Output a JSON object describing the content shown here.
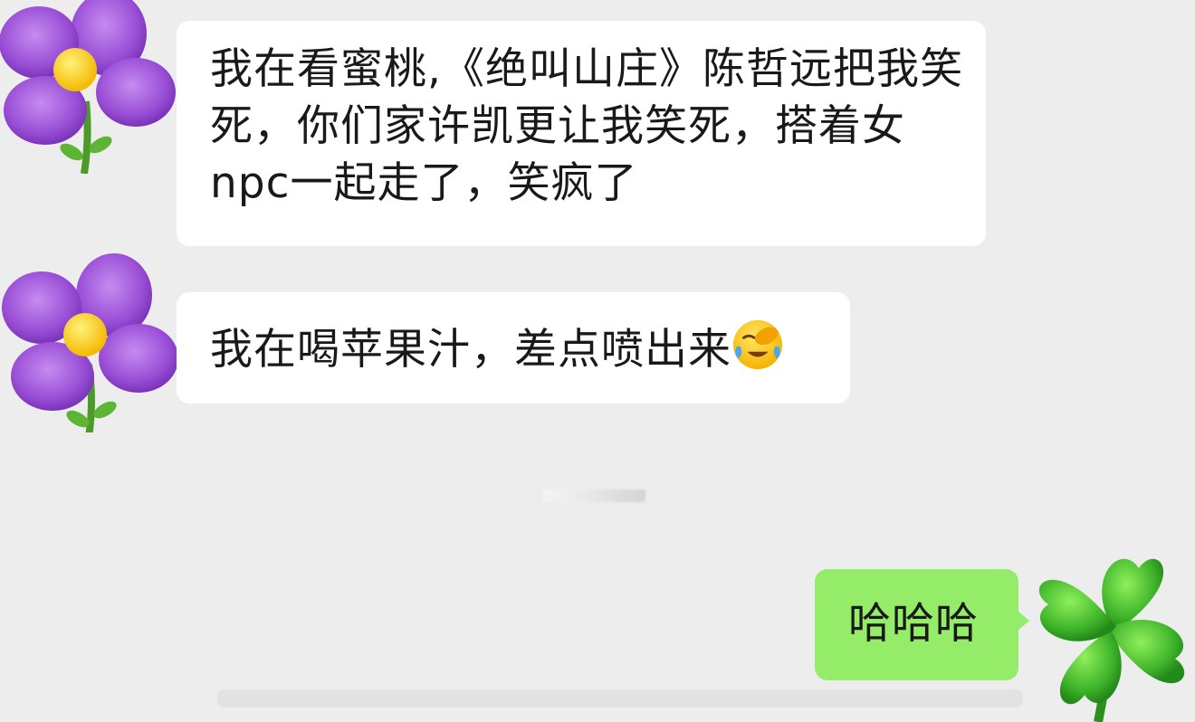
{
  "chat": {
    "messages": [
      {
        "sender": "contact",
        "avatar_icon": "purple-flower-icon",
        "text": "我在看蜜桃,《绝叫山庄》陈哲远把我笑死，你们家许凯更让我笑死，搭着女npc一起走了，笑疯了"
      },
      {
        "sender": "contact",
        "avatar_icon": "purple-flower-icon",
        "text": "我在喝苹果汁，差点喷出来",
        "emoji": "face-exhaling-tears-icon"
      },
      {
        "sender": "me",
        "avatar_icon": "four-leaf-clover-icon",
        "text": "哈哈哈"
      }
    ]
  },
  "colors": {
    "background": "#ededed",
    "incoming_bubble": "#ffffff",
    "outgoing_bubble": "#95ec69",
    "text": "#191919"
  }
}
